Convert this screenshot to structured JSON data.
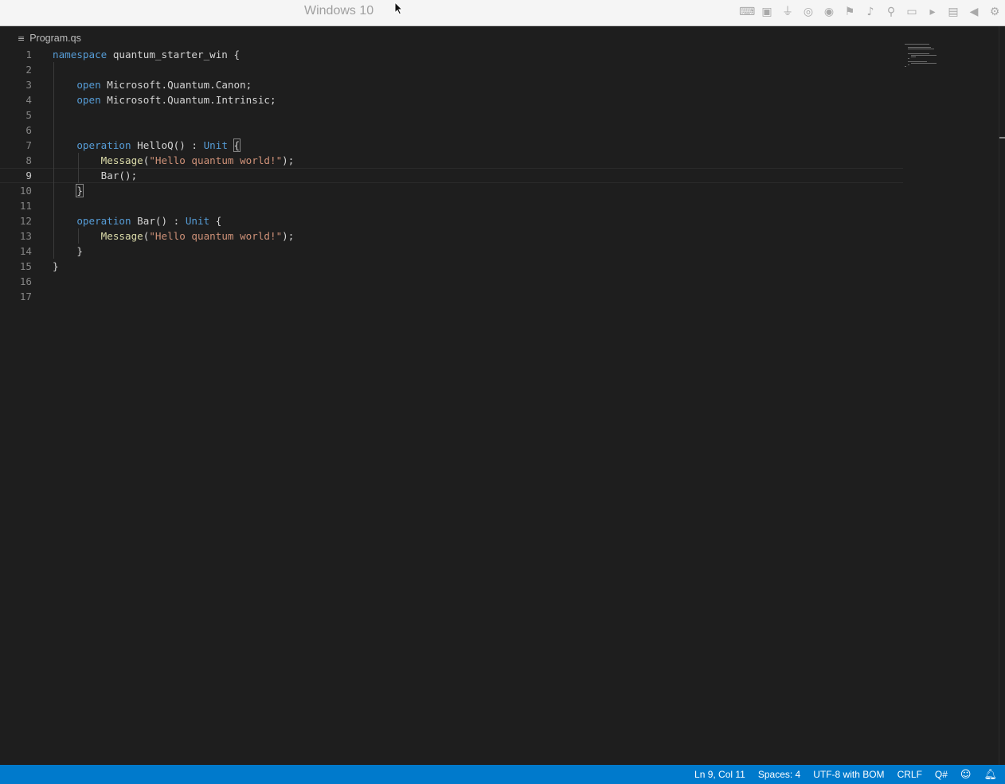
{
  "vm": {
    "title": "Windows 10",
    "icons": [
      "keyboard-icon",
      "cpu-icon",
      "usb-icon",
      "cd-disabled-icon",
      "disc-disabled-icon",
      "network-icon",
      "speaker-icon",
      "microphone-icon",
      "floppy-icon",
      "camera-icon",
      "shared-folder-icon",
      "back-arrow-icon",
      "settings-gear-icon"
    ]
  },
  "editor": {
    "filename": "Program.qs",
    "current_line": 9,
    "lines": [
      {
        "n": "1",
        "code": "namespace quantum_starter_win {"
      },
      {
        "n": "2",
        "code": ""
      },
      {
        "n": "3",
        "code": "    open Microsoft.Quantum.Canon;"
      },
      {
        "n": "4",
        "code": "    open Microsoft.Quantum.Intrinsic;"
      },
      {
        "n": "5",
        "code": ""
      },
      {
        "n": "6",
        "code": ""
      },
      {
        "n": "7",
        "code": "    operation HelloQ() : Unit {"
      },
      {
        "n": "8",
        "code": "        Message(\"Hello quantum world!\");"
      },
      {
        "n": "9",
        "code": "        Bar();"
      },
      {
        "n": "10",
        "code": "    }"
      },
      {
        "n": "11",
        "code": ""
      },
      {
        "n": "12",
        "code": "    operation Bar() : Unit {"
      },
      {
        "n": "13",
        "code": "        Message(\"Hello quantum world!\");"
      },
      {
        "n": "14",
        "code": "    }"
      },
      {
        "n": "15",
        "code": "}"
      },
      {
        "n": "16",
        "code": ""
      },
      {
        "n": "17",
        "code": ""
      }
    ]
  },
  "status_bar": {
    "position": "Ln 9, Col 11",
    "indent": "Spaces: 4",
    "encoding": "UTF-8 with BOM",
    "eol": "CRLF",
    "language": "Q#",
    "feedback_icon": "feedback-icon",
    "bell_icon": "bell-icon"
  },
  "colors": {
    "status_bar": "#007acc",
    "editor_bg": "#1e1e1e",
    "keyword": "#569cd6",
    "type": "#4ec9b0",
    "function": "#dcdcaa",
    "string": "#ce9178"
  }
}
